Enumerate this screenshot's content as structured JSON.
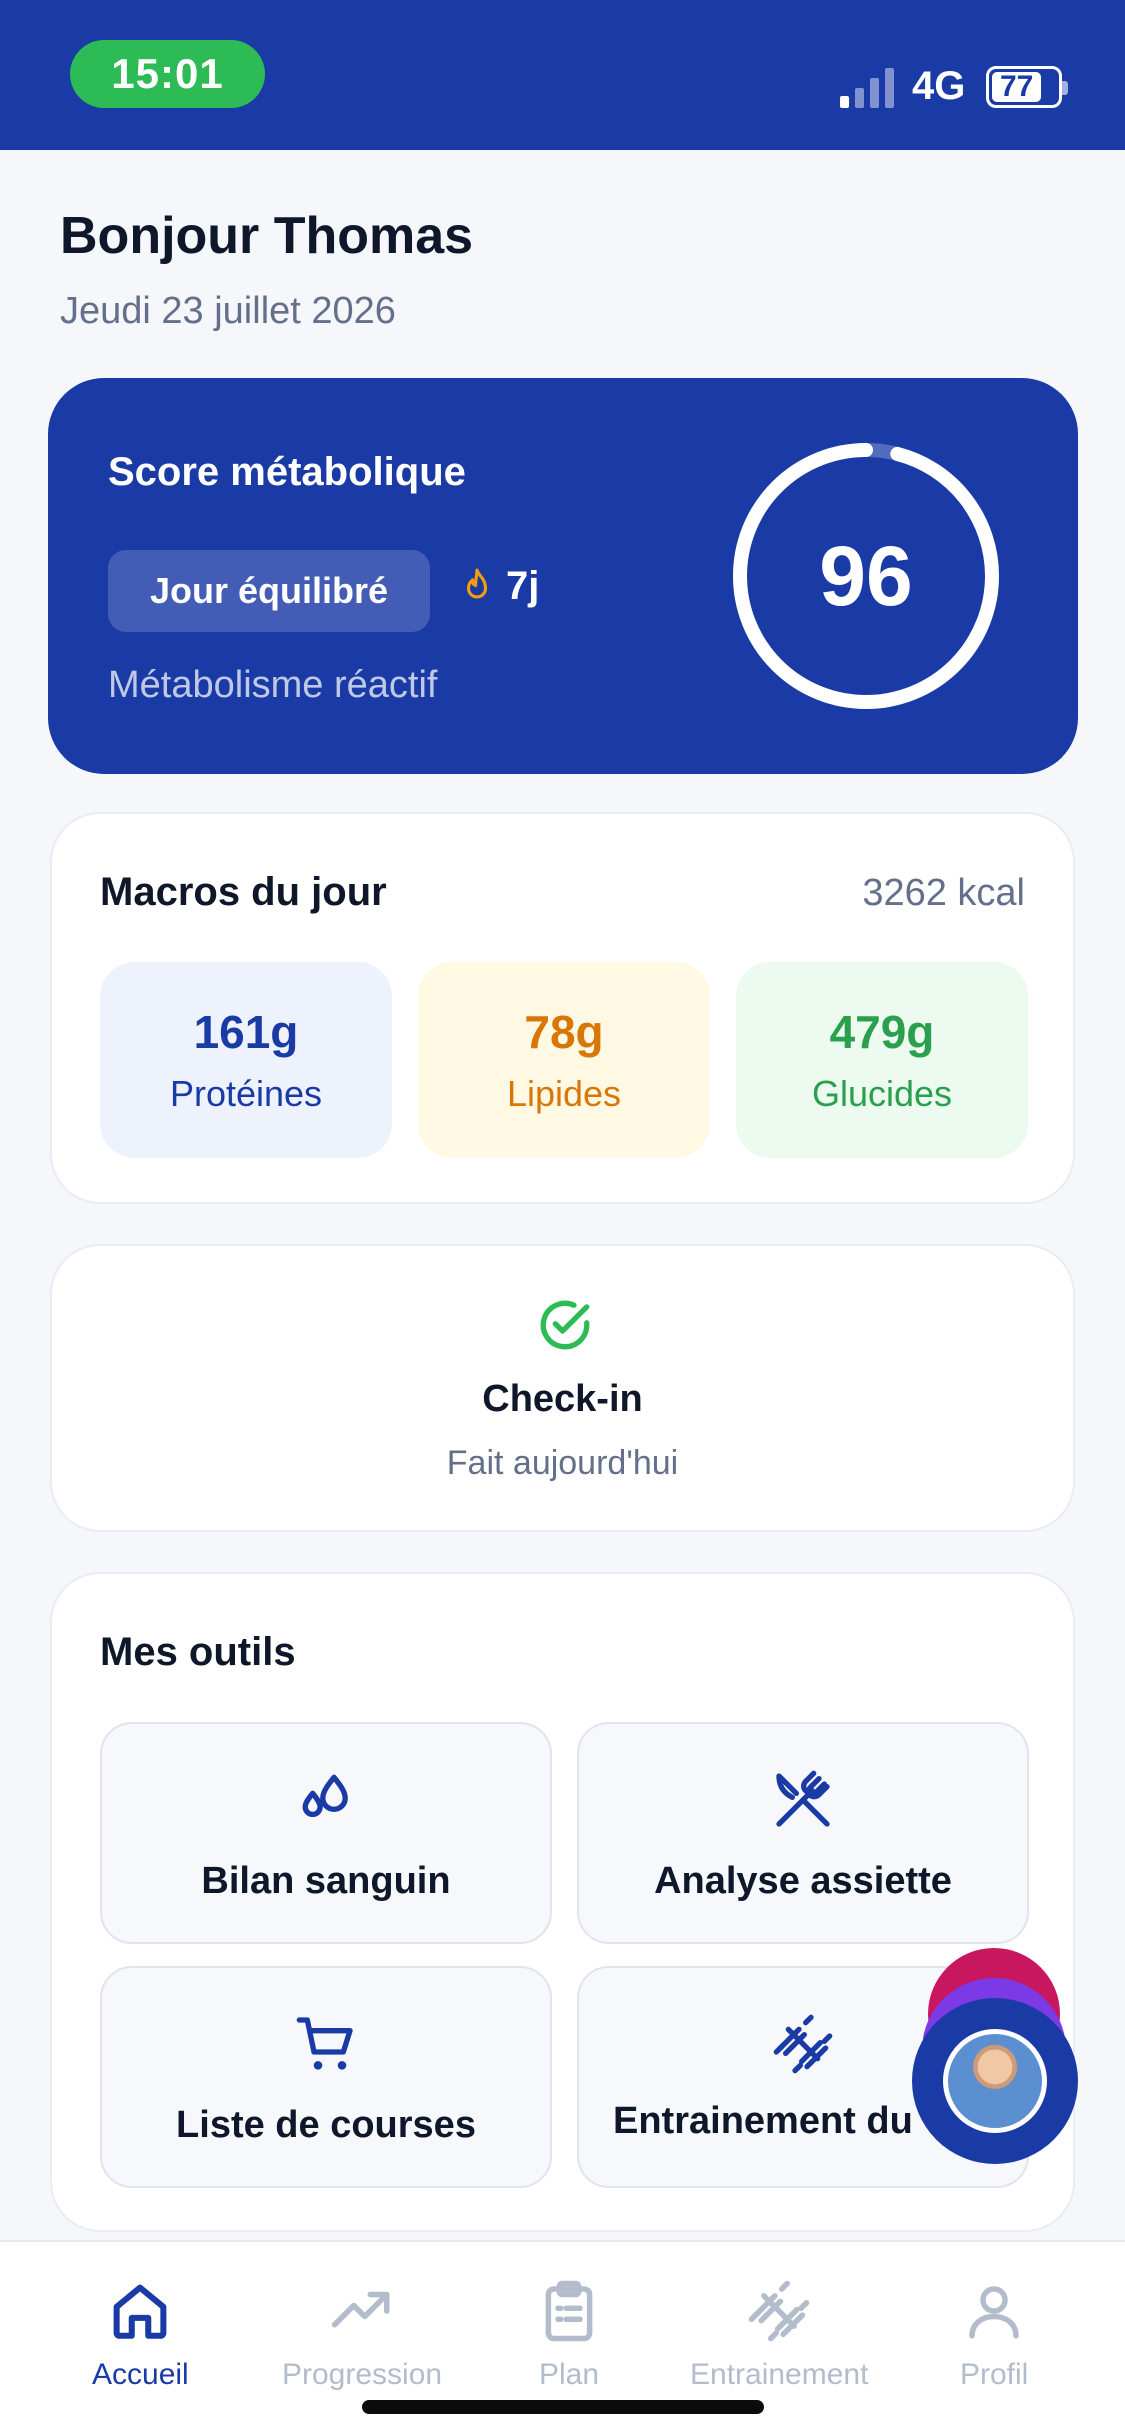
{
  "status_bar": {
    "time": "15:01",
    "network": "4G",
    "battery": "77",
    "battery_level": 0.77
  },
  "header": {
    "greeting": "Bonjour Thomas",
    "date": "Jeudi 23 juillet 2026"
  },
  "score_card": {
    "title": "Score métabolique",
    "badge": "Jour équilibré",
    "streak": "7j",
    "status": "Métabolisme réactif",
    "score": "96",
    "score_fraction": 0.96
  },
  "macros": {
    "title": "Macros du jour",
    "kcal": "3262 kcal",
    "items": [
      {
        "value": "161g",
        "label": "Protéines"
      },
      {
        "value": "78g",
        "label": "Lipides"
      },
      {
        "value": "479g",
        "label": "Glucides"
      }
    ]
  },
  "checkin": {
    "title": "Check-in",
    "subtitle": "Fait aujourd'hui"
  },
  "tools": {
    "title": "Mes outils",
    "items": [
      {
        "label": "Bilan sanguin",
        "icon": "blood-drops-icon"
      },
      {
        "label": "Analyse assiette",
        "icon": "utensils-cross-icon"
      },
      {
        "label": "Liste de courses",
        "icon": "shopping-cart-icon"
      },
      {
        "label": "Entrainement du",
        "icon": "dumbbell-icon"
      }
    ]
  },
  "nav": {
    "items": [
      {
        "label": "Accueil",
        "icon": "home-icon",
        "active": true
      },
      {
        "label": "Progression",
        "icon": "trending-up-icon"
      },
      {
        "label": "Plan",
        "icon": "clipboard-icon"
      },
      {
        "label": "Entrainement",
        "icon": "dumbbell-icon"
      },
      {
        "label": "Profil",
        "icon": "user-icon"
      }
    ]
  },
  "colors": {
    "primary": "#1a3aa6",
    "success": "#2dbb55",
    "protein": "#1a3aa6",
    "lipid": "#d97706",
    "carb": "#2aa04e"
  }
}
